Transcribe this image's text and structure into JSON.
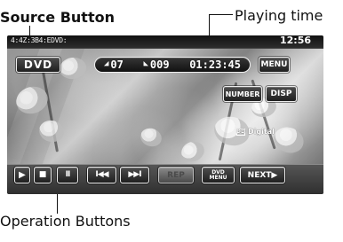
{
  "callouts": {
    "source_button": "Source Button",
    "playing_time": "Playing time",
    "operation_buttons": "Operation Buttons"
  },
  "status_bar": {
    "left_text": "4:4Z:3B4:EDVD:",
    "time": "12:56"
  },
  "source_button": {
    "label": "DVD"
  },
  "playback_info": {
    "title_number": "07",
    "chapter_number": "009",
    "playing_time": "01:23:45"
  },
  "top_controls": {
    "menu": "MENU",
    "number": "NUMBER",
    "disp": "DISP"
  },
  "audio_badge": {
    "dd_label": "DD",
    "label": "Digital"
  },
  "operation_buttons": {
    "play": "▶",
    "stop": "■",
    "pause": "II",
    "previous": "I◀◀",
    "next": "▶▶I",
    "repeat": "REP",
    "dvd_menu_top": "DVD",
    "dvd_menu_bottom": "MENU",
    "next_page": "NEXT▶"
  },
  "icons": {
    "source_badge": "dvd-badge-icon",
    "title": "title-icon",
    "chapter": "chapter-icon",
    "dolby_digital": "dolby-digital-icon"
  }
}
